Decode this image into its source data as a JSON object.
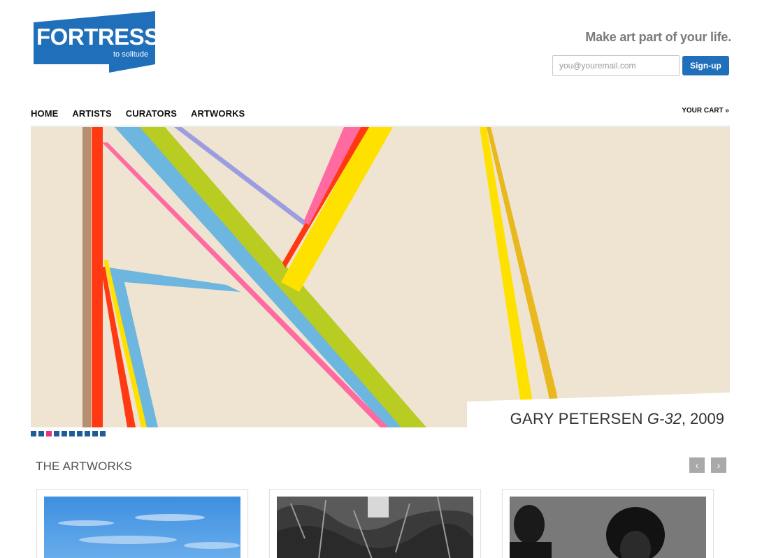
{
  "logo": {
    "name": "FORTRESS",
    "subtitle": "to solitude",
    "color": "#1f6fba"
  },
  "header": {
    "tagline": "Make art part of your life.",
    "email_placeholder": "you@youremail.com",
    "signup_label": "Sign-up"
  },
  "nav": {
    "items": [
      {
        "label": "HOME"
      },
      {
        "label": "ARTISTS"
      },
      {
        "label": "CURATORS"
      },
      {
        "label": "ARTWORKS"
      }
    ],
    "cart_label": "YOUR CART »"
  },
  "hero": {
    "artist": "GARY PETERSEN",
    "title": "G-32",
    "year": ", 2009",
    "background": "#f0e4d4"
  },
  "pager": {
    "count": 10,
    "active_index": 2,
    "color": "#1e5d97",
    "active_color": "#e6357a"
  },
  "artworks": {
    "heading": "THE ARTWORKS",
    "prev_icon": "‹",
    "next_icon": "›"
  },
  "colors": {
    "accent": "#1f6fba",
    "hot_pink": "#e6357a"
  }
}
